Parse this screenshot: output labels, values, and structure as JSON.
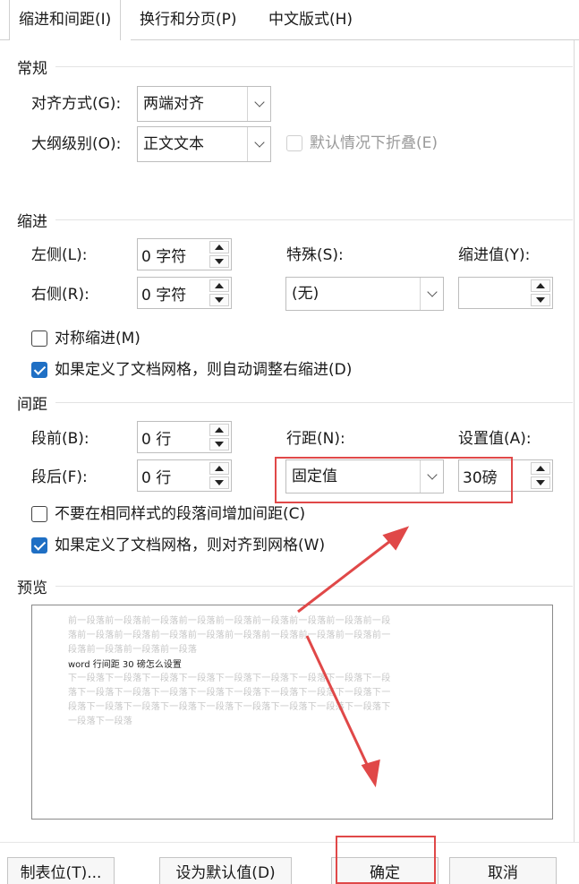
{
  "tabs": [
    {
      "label": "缩进和间距(I)"
    },
    {
      "label": "换行和分页(P)"
    },
    {
      "label": "中文版式(H)"
    }
  ],
  "general": {
    "title": "常规",
    "alignment_label": "对齐方式(G):",
    "alignment_value": "两端对齐",
    "outline_label": "大纲级别(O):",
    "outline_value": "正文文本",
    "collapse_label": "默认情况下折叠(E)"
  },
  "indent": {
    "title": "缩进",
    "left_label": "左侧(L):",
    "left_value": "0 字符",
    "right_label": "右侧(R):",
    "right_value": "0 字符",
    "special_label": "特殊(S):",
    "special_value": "(无)",
    "by_label": "缩进值(Y):",
    "by_value": "",
    "mirror_label": "对称缩进(M)",
    "auto_adjust_label": "如果定义了文档网格，则自动调整右缩进(D)"
  },
  "spacing": {
    "title": "间距",
    "before_label": "段前(B):",
    "before_value": "0 行",
    "after_label": "段后(F):",
    "after_value": "0 行",
    "line_label": "行距(N):",
    "line_value": "固定值",
    "at_label": "设置值(A):",
    "at_value": "30磅",
    "no_space_label": "不要在相同样式的段落间增加间距(C)",
    "snap_grid_label": "如果定义了文档网格，则对齐到网格(W)"
  },
  "preview": {
    "title": "预览",
    "prev_lines": [
      "前一段落前一段落前一段落前一段落前一段落前一段落前一段落前一段落前一段",
      "落前一段落前一段落前一段落前一段落前一段落前一段落前一段落前一段落前一",
      "段落前一段落前一段落前一段落"
    ],
    "sample": "word 行间距 30 磅怎么设置",
    "next_lines": [
      "下一段落下一段落下一段落下一段落下一段落下一段落下一段落下一段落下一段",
      "落下一段落下一段落下一段落下一段落下一段落下一段落下一段落下一段落下一",
      "段落下一段落下一段落下一段落下一段落下一段落下一段落下一段落下一段落下",
      "一段落下一段落"
    ]
  },
  "buttons": {
    "tabs": "制表位(T)...",
    "default": "设为默认值(D)",
    "ok": "确定",
    "cancel": "取消"
  },
  "colors": {
    "accent": "#1f6fc4",
    "annotation": "#e04848"
  }
}
